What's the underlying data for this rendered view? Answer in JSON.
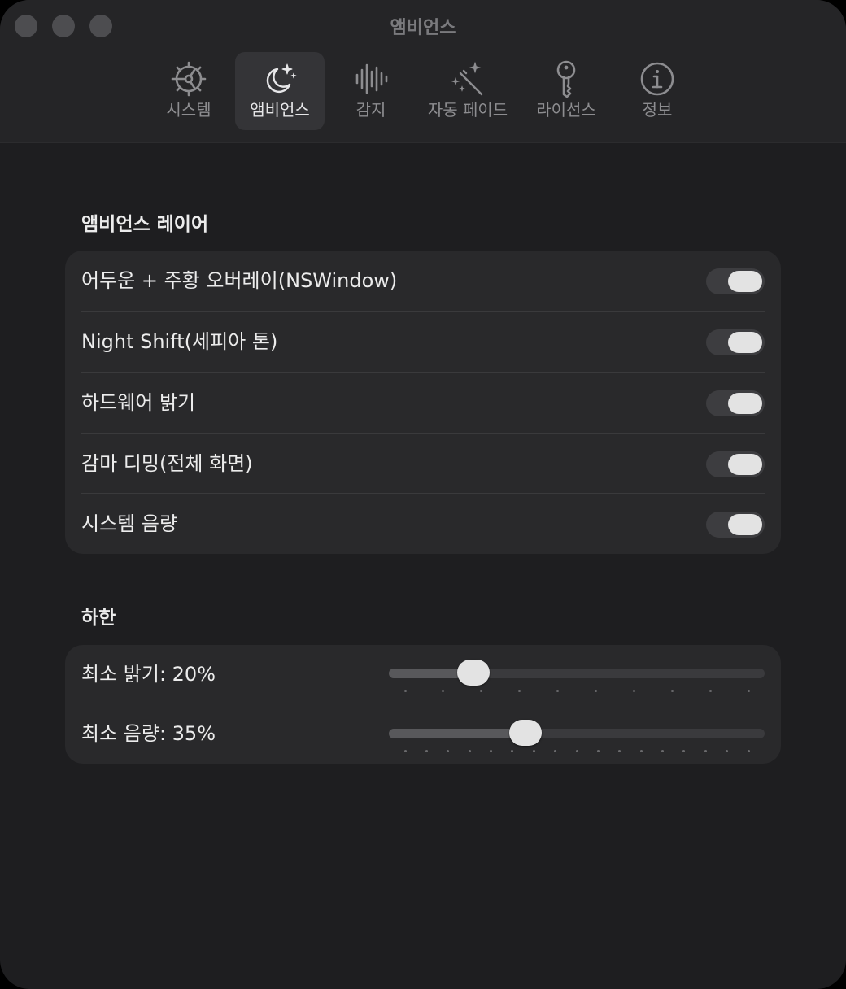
{
  "window": {
    "title": "앰비언스"
  },
  "toolbar": {
    "tabs": [
      {
        "label": "시스템",
        "icon": "gear-icon"
      },
      {
        "label": "앰비언스",
        "icon": "moon-stars-icon",
        "active": true
      },
      {
        "label": "감지",
        "icon": "waveform-icon"
      },
      {
        "label": "자동 페이드",
        "icon": "magic-wand-icon"
      },
      {
        "label": "라이선스",
        "icon": "key-icon"
      },
      {
        "label": "정보",
        "icon": "info-icon"
      }
    ]
  },
  "layers": {
    "title": "앰비언스 레이어",
    "items": [
      {
        "label": "어두운 + 주황 오버레이(NSWindow)",
        "on": true
      },
      {
        "label": "Night Shift(세피아 톤)",
        "on": true
      },
      {
        "label": "하드웨어 밝기",
        "on": true
      },
      {
        "label": "감마 디밍(전체 화면)",
        "on": true
      },
      {
        "label": "시스템 음량",
        "on": true
      }
    ]
  },
  "limits": {
    "title": "하한",
    "brightness": {
      "label": "최소 밝기: 20%",
      "value": 0.2,
      "ticks": 10
    },
    "volume": {
      "label": "최소 음량: 35%",
      "value": 0.35,
      "ticks": 17
    }
  }
}
